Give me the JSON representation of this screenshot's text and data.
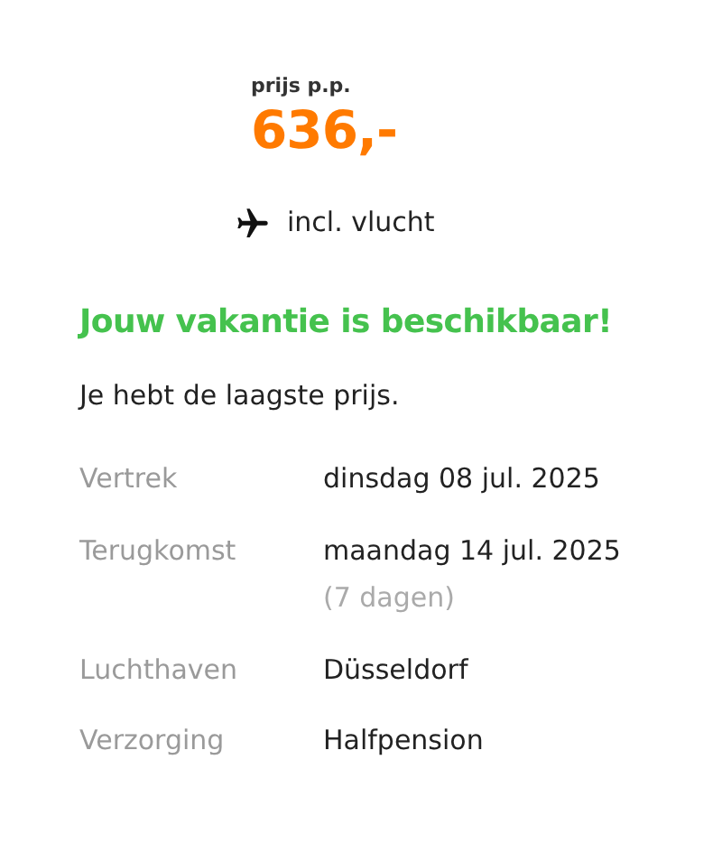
{
  "price": {
    "label": "prijs p.p.",
    "amount": "636,-"
  },
  "flight": {
    "text": "incl. vlucht"
  },
  "headline": "Jouw vakantie is beschikbaar!",
  "subline": "Je hebt de laagste prijs.",
  "details": [
    {
      "label": "Vertrek",
      "value": "dinsdag 08 jul. 2025"
    },
    {
      "label": "Terugkomst",
      "value": "maandag 14 jul. 2025",
      "note": "(7 dagen)"
    },
    {
      "label": "Luchthaven",
      "value": "Düsseldorf"
    },
    {
      "label": "Verzorging",
      "value": "Halfpension"
    }
  ]
}
